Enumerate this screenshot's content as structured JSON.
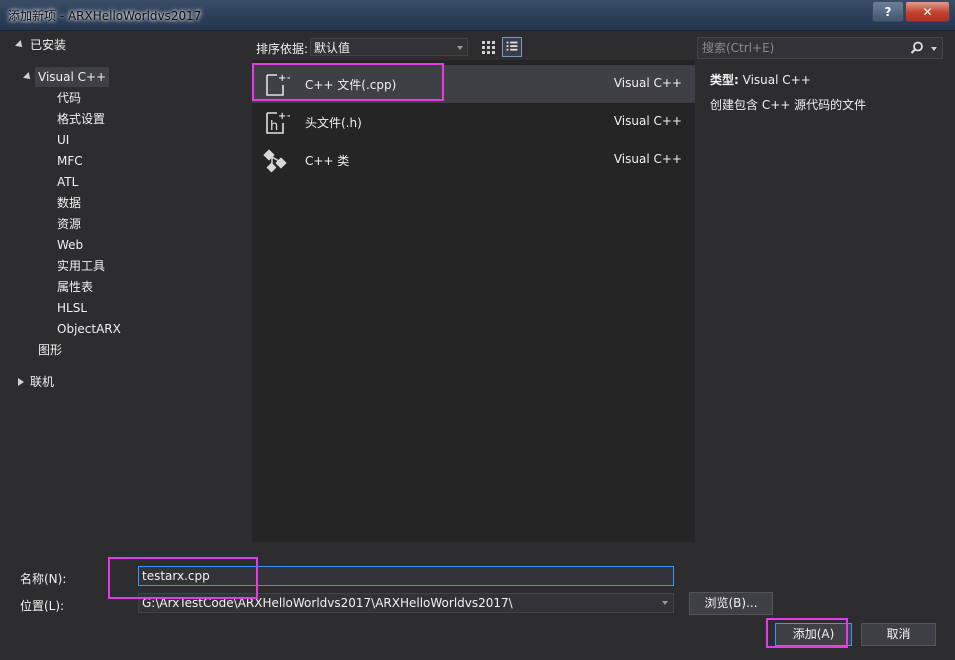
{
  "window": {
    "title": "添加新项 - ARXHelloWorldvs2017",
    "help_label": "?",
    "close_label": "✕"
  },
  "tree": {
    "installed": "已安装",
    "visual_cpp": "Visual C++",
    "children": [
      "代码",
      "格式设置",
      "UI",
      "MFC",
      "ATL",
      "数据",
      "资源",
      "Web",
      "实用工具",
      "属性表",
      "HLSL",
      "ObjectARX"
    ],
    "graphics": "图形",
    "online": "联机"
  },
  "toolbar": {
    "sort_label": "排序依据:",
    "sort_value": "默认值"
  },
  "templates": [
    {
      "name": "C++ 文件(.cpp)",
      "lang": "Visual C++",
      "icon": "cpp-file-icon"
    },
    {
      "name": "头文件(.h)",
      "lang": "Visual C++",
      "icon": "header-file-icon"
    },
    {
      "name": "C++ 类",
      "lang": "Visual C++",
      "icon": "cpp-class-icon"
    }
  ],
  "details": {
    "type_label": "类型:",
    "type_value": "Visual C++",
    "description": "创建包含 C++ 源代码的文件"
  },
  "search": {
    "placeholder": "搜索(Ctrl+E)"
  },
  "form": {
    "name_label": "名称(N):",
    "name_value": "testarx.cpp",
    "location_label": "位置(L):",
    "location_value": "G:\\ArxTestCode\\ARXHelloWorldvs2017\\ARXHelloWorldvs2017\\",
    "browse_label": "浏览(B)...",
    "add_label": "添加(A)",
    "cancel_label": "取消"
  },
  "colors": {
    "background": "#2d2d30",
    "pane": "#252526",
    "selection": "#3f3f46",
    "accent": "#3399ff",
    "highlight": "#e63ae6"
  }
}
